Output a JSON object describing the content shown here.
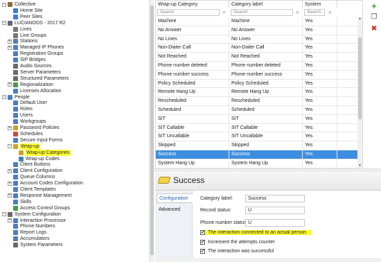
{
  "tree": {
    "nodes": [
      {
        "label": "Collective",
        "level": 0,
        "exp": "-",
        "color": "#8a6b3a"
      },
      {
        "label": "Home Site",
        "level": 1,
        "exp": "",
        "color": "#3b7dd8"
      },
      {
        "label": "Peer Sites",
        "level": 1,
        "exp": "",
        "color": "#3b7dd8"
      },
      {
        "label": "LUCIANODS - 2017 R2",
        "level": 0,
        "exp": "-",
        "color": "#5a6a7a"
      },
      {
        "label": "Lines",
        "level": 1,
        "exp": "",
        "color": "#777777"
      },
      {
        "label": "Line Groups",
        "level": 1,
        "exp": "",
        "color": "#777777"
      },
      {
        "label": "Stations",
        "level": 1,
        "exp": "+",
        "color": "#4a7fbf"
      },
      {
        "label": "Managed IP Phones",
        "level": 1,
        "exp": "+",
        "color": "#4a7fbf"
      },
      {
        "label": "Registration Groups",
        "level": 1,
        "exp": "",
        "color": "#4a7fbf"
      },
      {
        "label": "SIP Bridges",
        "level": 1,
        "exp": "",
        "color": "#4a7fbf"
      },
      {
        "label": "Audio Sources",
        "level": 1,
        "exp": "",
        "color": "#6a6a6a"
      },
      {
        "label": "Server Parameters",
        "level": 1,
        "exp": "",
        "color": "#6a6a6a"
      },
      {
        "label": "Structured Parameters",
        "level": 1,
        "exp": "",
        "color": "#6a6a6a"
      },
      {
        "label": "Regionalization",
        "level": 1,
        "exp": "+",
        "color": "#4a9a4a"
      },
      {
        "label": "Licenses Allocation",
        "level": 1,
        "exp": "",
        "color": "#4a7fbf"
      },
      {
        "label": "People",
        "level": 0,
        "exp": "-",
        "color": "#4a7fbf"
      },
      {
        "label": "Default User",
        "level": 1,
        "exp": "",
        "color": "#4a7fbf"
      },
      {
        "label": "Roles",
        "level": 1,
        "exp": "",
        "color": "#4a7fbf"
      },
      {
        "label": "Users",
        "level": 1,
        "exp": "",
        "color": "#4a7fbf"
      },
      {
        "label": "Workgroups",
        "level": 1,
        "exp": "",
        "color": "#4a7fbf"
      },
      {
        "label": "Password Policies",
        "level": 1,
        "exp": "+",
        "color": "#c9a227"
      },
      {
        "label": "Schedules",
        "level": 1,
        "exp": "",
        "color": "#c94a3a"
      },
      {
        "label": "Secure Input Forms",
        "level": 1,
        "exp": "",
        "color": "#4a7fbf"
      },
      {
        "label": "Wrap-up",
        "level": 1,
        "exp": "-",
        "color": "#d2a21f",
        "highlight": true
      },
      {
        "label": "Wrap-up Categories",
        "level": 2,
        "exp": "",
        "color": "#d2a21f",
        "highlight": true
      },
      {
        "label": "Wrap-up Codes",
        "level": 2,
        "exp": "",
        "color": "#4a7fbf"
      },
      {
        "label": "Client Buttons",
        "level": 1,
        "exp": "",
        "color": "#4a7fbf"
      },
      {
        "label": "Client Configuration",
        "level": 1,
        "exp": "+",
        "color": "#4a7fbf"
      },
      {
        "label": "Queue Columns",
        "level": 1,
        "exp": "",
        "color": "#4a7fbf"
      },
      {
        "label": "Account Codes Configuration",
        "level": 1,
        "exp": "+",
        "color": "#4a7fbf"
      },
      {
        "label": "Client Templates",
        "level": 1,
        "exp": "",
        "color": "#4a7fbf"
      },
      {
        "label": "Response Management",
        "level": 1,
        "exp": "+",
        "color": "#4a7fbf"
      },
      {
        "label": "Skills",
        "level": 1,
        "exp": "",
        "color": "#4a7fbf"
      },
      {
        "label": "Access Control Groups",
        "level": 1,
        "exp": "",
        "color": "#4a9a4a"
      },
      {
        "label": "System Configuration",
        "level": 0,
        "exp": "-",
        "color": "#6a6a6a"
      },
      {
        "label": "Interaction Processor",
        "level": 1,
        "exp": "+",
        "color": "#4a7fbf"
      },
      {
        "label": "Phone Numbers",
        "level": 1,
        "exp": "",
        "color": "#4a7fbf"
      },
      {
        "label": "Report Logs",
        "level": 1,
        "exp": "",
        "color": "#4a7fbf"
      },
      {
        "label": "Accumulators",
        "level": 1,
        "exp": "",
        "color": "#4a7fbf"
      },
      {
        "label": "System Parameters",
        "level": 1,
        "exp": "",
        "color": "#6a6a6a"
      }
    ]
  },
  "grid": {
    "headers": [
      "Wrap-up Category",
      "Category label",
      "System"
    ],
    "search_placeholder": "Search",
    "rows": [
      [
        "Machine",
        "Machine",
        "Yes"
      ],
      [
        "No Answer",
        "No Answer",
        "Yes"
      ],
      [
        "No Lines",
        "No Lines",
        "Yes"
      ],
      [
        "Non-Dialer Call",
        "Non-Dialer Call",
        "Yes"
      ],
      [
        "Not Reached",
        "Not Reached",
        "Yes"
      ],
      [
        "Phone number deleted",
        "Phone number deleted",
        "Yes"
      ],
      [
        "Phone number success",
        "Phone number success",
        "Yes"
      ],
      [
        "Policy Scheduled",
        "Policy Scheduled",
        "Yes"
      ],
      [
        "Remote Hang Up",
        "Remote Hang Up",
        "Yes"
      ],
      [
        "Rescheduled",
        "Rescheduled",
        "Yes"
      ],
      [
        "Scheduled",
        "Scheduled",
        "Yes"
      ],
      [
        "SIT",
        "SIT",
        "Yes"
      ],
      [
        "SIT Callable",
        "SIT Callable",
        "Yes"
      ],
      [
        "SIT Uncallable",
        "SIT Uncallable",
        "Yes"
      ],
      [
        "Skipped",
        "Skipped",
        "Yes"
      ],
      [
        "Success",
        "Success",
        "Yes"
      ],
      [
        "System Hang Up",
        "System Hang Up",
        "Yes"
      ]
    ],
    "selected_index": 15
  },
  "detail": {
    "title": "Success",
    "tabs": [
      "Configuration",
      "Advanced"
    ],
    "fields": {
      "category_label": {
        "label": "Category label:",
        "value": "Success"
      },
      "record_status": {
        "label": "Record status:",
        "value": "U"
      },
      "phone_status": {
        "label": "Phone number status:",
        "value": "U"
      }
    },
    "checks": [
      {
        "label": "The interaction connected to an actual person",
        "checked": true,
        "highlight": true
      },
      {
        "label": "Increment the attempts counter",
        "checked": true,
        "highlight": false
      },
      {
        "label": "The interaction was successful",
        "checked": true,
        "highlight": false
      }
    ]
  },
  "toolbar": {
    "add": "+",
    "copy": "❐",
    "delete": "✖"
  },
  "colors": {
    "selected_row": "#3d8ee0",
    "highlight": "#ffff2e"
  }
}
